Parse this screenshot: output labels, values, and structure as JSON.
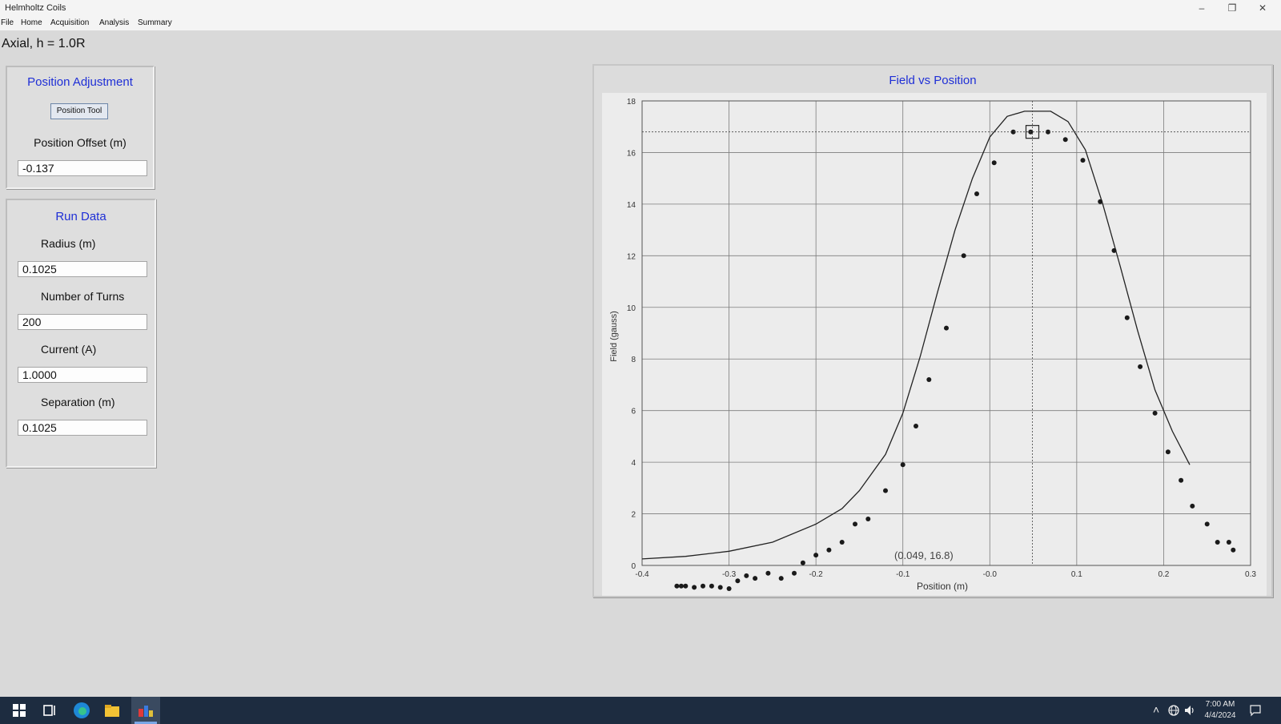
{
  "window": {
    "title": "Helmholtz Coils",
    "controls": {
      "minimize": "–",
      "restore": "❐",
      "close": "✕"
    }
  },
  "menu": [
    "File",
    "Home",
    "Acquisition",
    "Analysis",
    "Summary"
  ],
  "mode_label": "Axial, h = 1.0R",
  "position_panel": {
    "title": "Position Adjustment",
    "button_label": "Position Tool",
    "offset_label": "Position Offset (m)",
    "offset_value": "-0.137"
  },
  "run_panel": {
    "title": "Run Data",
    "radius_label": "Radius (m)",
    "radius_value": "0.1025",
    "turns_label": "Number of Turns",
    "turns_value": "200",
    "current_label": "Current (A)",
    "current_value": "1.0000",
    "separation_label": "Separation (m)",
    "separation_value": "0.1025"
  },
  "chart_data": {
    "type": "scatter",
    "title": "Field vs Position",
    "xlabel": "Position (m)",
    "ylabel": "Field (gauss)",
    "xlim": [
      -0.4,
      0.3
    ],
    "ylim": [
      0,
      18
    ],
    "xticks": [
      "-0.4",
      "-0.3",
      "-0.2",
      "-0.1",
      "-0.0",
      "0.1",
      "0.2",
      "0.3"
    ],
    "yticks": [
      "0",
      "2",
      "4",
      "6",
      "8",
      "10",
      "12",
      "14",
      "16",
      "18"
    ],
    "grid": true,
    "cursor": {
      "x": 0.049,
      "y": 16.8,
      "readout": "(0.049, 16.8)"
    },
    "series": [
      {
        "kind": "points",
        "x": [
          -0.36,
          -0.355,
          -0.35,
          -0.34,
          -0.33,
          -0.32,
          -0.31,
          -0.3,
          -0.29,
          -0.28,
          -0.27,
          -0.255,
          -0.24,
          -0.225,
          -0.215,
          -0.2,
          -0.185,
          -0.17,
          -0.155,
          -0.14,
          -0.12,
          -0.1,
          -0.085,
          -0.07,
          -0.05,
          -0.03,
          -0.015,
          0.005,
          0.027,
          0.047,
          0.067,
          0.087,
          0.107,
          0.127,
          0.143,
          0.158,
          0.173,
          0.19,
          0.205,
          0.22,
          0.233,
          0.25,
          0.262,
          0.275,
          0.28
        ],
        "y": [
          -0.8,
          -0.8,
          -0.8,
          -0.85,
          -0.8,
          -0.8,
          -0.85,
          -0.9,
          -0.6,
          -0.4,
          -0.5,
          -0.3,
          -0.5,
          -0.3,
          0.1,
          0.4,
          0.6,
          0.9,
          1.6,
          1.8,
          2.9,
          3.9,
          5.4,
          7.2,
          9.2,
          12.0,
          14.4,
          15.6,
          16.8,
          16.8,
          16.8,
          16.5,
          15.7,
          14.1,
          12.2,
          9.6,
          7.7,
          5.9,
          4.4,
          3.3,
          2.3,
          1.6,
          0.9,
          0.9,
          0.6
        ]
      },
      {
        "kind": "line",
        "x": [
          -0.4,
          -0.35,
          -0.3,
          -0.25,
          -0.2,
          -0.17,
          -0.15,
          -0.12,
          -0.1,
          -0.08,
          -0.06,
          -0.04,
          -0.02,
          0.0,
          0.02,
          0.04,
          0.05,
          0.07,
          0.09,
          0.11,
          0.13,
          0.15,
          0.17,
          0.19,
          0.21,
          0.23
        ],
        "y": [
          0.25,
          0.35,
          0.55,
          0.9,
          1.6,
          2.2,
          2.9,
          4.3,
          5.9,
          8.1,
          10.6,
          13.0,
          15.0,
          16.6,
          17.4,
          17.6,
          17.6,
          17.6,
          17.2,
          16.1,
          14.0,
          11.6,
          9.1,
          6.8,
          5.2,
          3.9
        ]
      }
    ]
  },
  "taskbar": {
    "time": "7:00 AM",
    "date": "4/4/2024",
    "icons": [
      "windows-icon",
      "task-view-icon",
      "edge-icon",
      "file-explorer-icon",
      "helmholtz-app-icon"
    ]
  }
}
